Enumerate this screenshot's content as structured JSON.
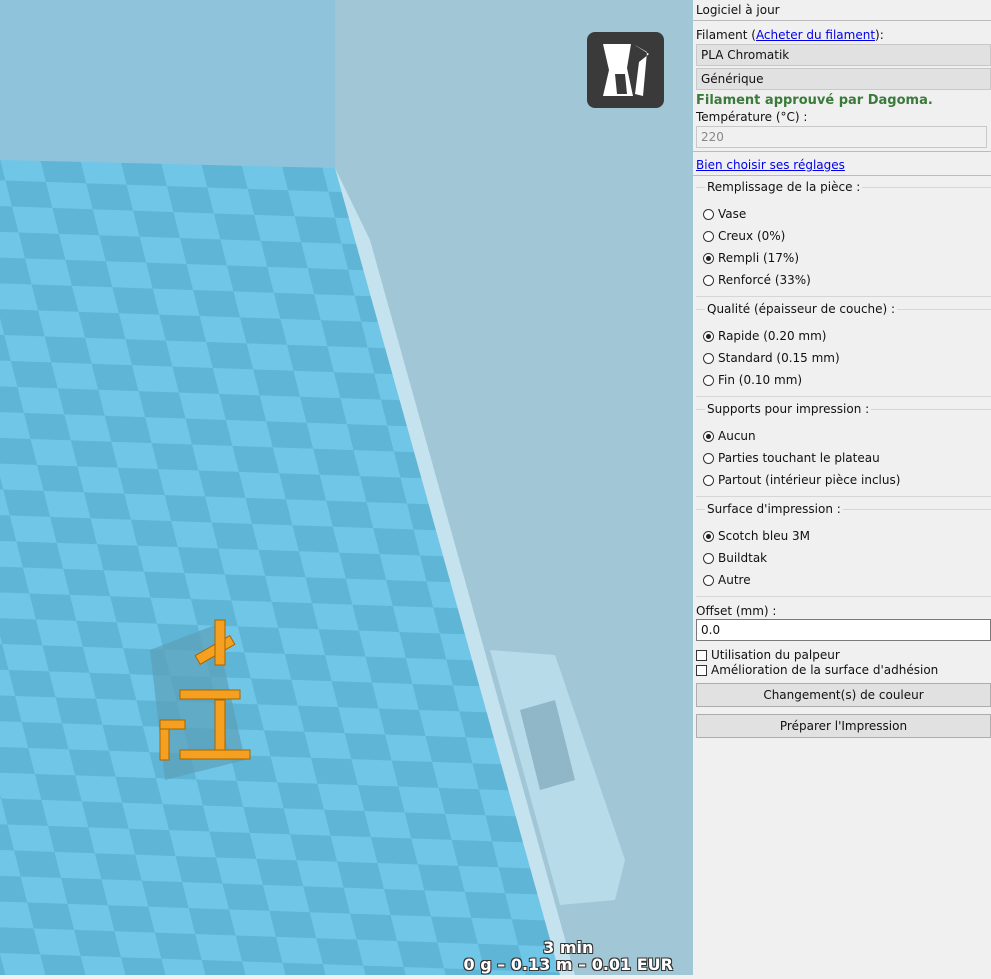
{
  "viewport": {
    "print_time": "3 min",
    "print_stats": "0 g – 0.13 m – 0.01 EUR",
    "logo_icon": "dagoma-logo-icon"
  },
  "panel": {
    "status": "Logiciel à jour",
    "filament_label_pre": "Filament (",
    "filament_link": "Acheter du filament",
    "filament_label_post": "):",
    "filament_value": "PLA Chromatik",
    "filament_brand": "Générique",
    "approved": "Filament approuvé par Dagoma.",
    "temp_label": "Température (°C) :",
    "temp_value": "220",
    "settings_link": "Bien choisir ses réglages",
    "groups": [
      {
        "title": "Remplissage de la pièce :",
        "options": [
          "Vase",
          "Creux (0%)",
          "Rempli (17%)",
          "Renforcé (33%)"
        ],
        "selected": 2
      },
      {
        "title": "Qualité (épaisseur de couche) :",
        "options": [
          "Rapide (0.20 mm)",
          "Standard (0.15 mm)",
          "Fin (0.10 mm)"
        ],
        "selected": 0
      },
      {
        "title": "Supports pour impression :",
        "options": [
          "Aucun",
          "Parties touchant le plateau",
          "Partout (intérieur pièce inclus)"
        ],
        "selected": 0
      },
      {
        "title": "Surface d'impression :",
        "options": [
          "Scotch bleu 3M",
          "Buildtak",
          "Autre"
        ],
        "selected": 0
      }
    ],
    "offset_label": "Offset (mm) :",
    "offset_value": "0.0",
    "checkbox_probe": "Utilisation du palpeur",
    "checkbox_adhesion": "Amélioration de la surface d'adhésion",
    "color_change_button": "Changement(s) de couleur",
    "prepare_button": "Préparer l'Impression"
  },
  "colors": {
    "approved": "#3a7a3a",
    "model": "#f5a020"
  }
}
